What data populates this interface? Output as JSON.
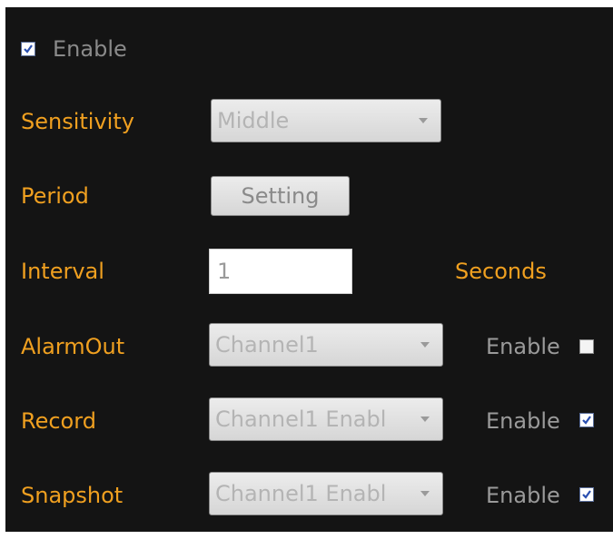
{
  "enable": {
    "label": "Enable",
    "checked": true
  },
  "sensitivity": {
    "label": "Sensitivity",
    "value": "Middle"
  },
  "period": {
    "label": "Period",
    "button_label": "Setting"
  },
  "interval": {
    "label": "Interval",
    "value": "1",
    "unit": "Seconds"
  },
  "alarm_out": {
    "label": "AlarmOut",
    "value": "Channel1",
    "enable_label": "Enable",
    "checked": false
  },
  "record": {
    "label": "Record",
    "value": "Channel1 Enabl",
    "enable_label": "Enable",
    "checked": true
  },
  "snapshot": {
    "label": "Snapshot",
    "value": "Channel1 Enabl",
    "enable_label": "Enable",
    "checked": true
  },
  "colors": {
    "background": "#141414",
    "label": "#f0a020",
    "control_text": "#b4b4b4",
    "check_mark": "#2a4fb0"
  }
}
